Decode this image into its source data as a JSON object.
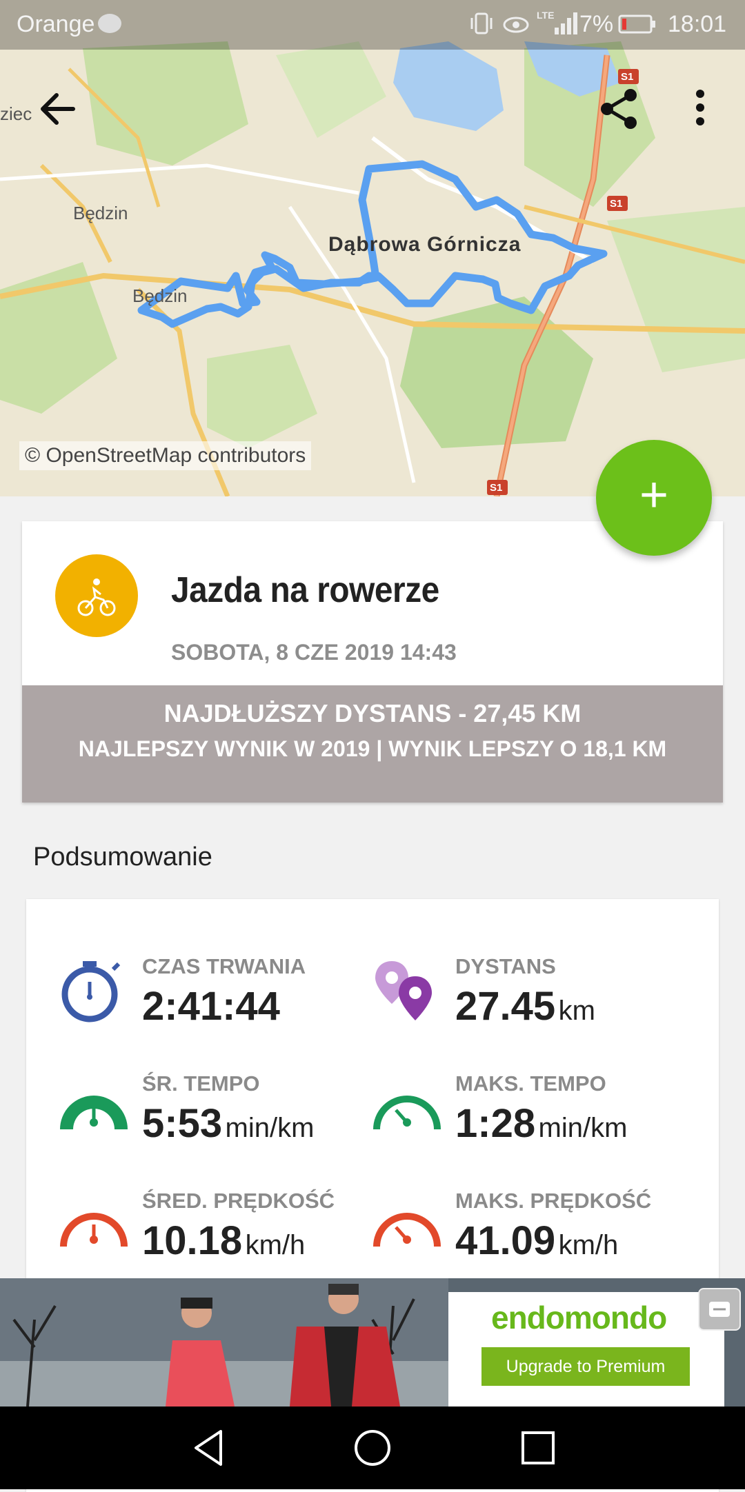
{
  "status_bar": {
    "carrier": "Orange",
    "battery": "7%",
    "time": "18:01",
    "network": "LTE"
  },
  "map": {
    "attribution": "© OpenStreetMap contributors",
    "labels": {
      "city": "Dąbrowa Górnicza",
      "town1": "Będzin",
      "town2": "Będzin",
      "edge": "ziec",
      "road": "S1"
    }
  },
  "toolbar": {
    "back_icon": "arrow-left-icon",
    "share_icon": "share-icon",
    "more_icon": "more-vert-icon"
  },
  "fab": {
    "label": "+"
  },
  "workout": {
    "sport": "Jazda na rowerze",
    "date": "SOBOTA, 8 CZE 2019 14:43",
    "record_line1": "NAJDŁUŻSZY DYSTANS  -  27,45 KM",
    "record_line2": "NAJLEPSZY WYNIK W 2019  |  WYNIK LEPSZY O 18,1 KM"
  },
  "summary": {
    "title": "Podsumowanie",
    "stats": [
      {
        "label": "CZAS TRWANIA",
        "value": "2:41:44",
        "unit": "",
        "icon": "stopwatch-icon",
        "color": "#3b5aa8"
      },
      {
        "label": "DYSTANS",
        "value": "27.45",
        "unit": "km",
        "icon": "map-pin-icon",
        "color": "#8a3aa5"
      },
      {
        "label": "ŚR. TEMPO",
        "value": "5:53",
        "unit": "min/km",
        "icon": "gauge-icon",
        "color": "#1a9a5a"
      },
      {
        "label": "MAKS. TEMPO",
        "value": "1:28",
        "unit": "min/km",
        "icon": "gauge-icon",
        "color": "#1a9a5a"
      },
      {
        "label": "ŚRED. PRĘDKOŚĆ",
        "value": "10.18",
        "unit": "km/h",
        "icon": "speedometer-icon",
        "color": "#e2492a"
      },
      {
        "label": "MAKS. PRĘDKOŚĆ",
        "value": "41.09",
        "unit": "km/h",
        "icon": "speedometer-icon",
        "color": "#e2492a"
      }
    ]
  },
  "ad": {
    "brand": "endomondo",
    "button": "Upgrade to Premium"
  },
  "nav": {
    "back": "nav-back-icon",
    "home": "nav-home-icon",
    "recents": "nav-recents-icon"
  },
  "colors": {
    "accent_green": "#6cc01a",
    "sport_yellow": "#f2b100",
    "route_blue": "#5aa0f0",
    "banner_gray": "#ada5a5"
  }
}
